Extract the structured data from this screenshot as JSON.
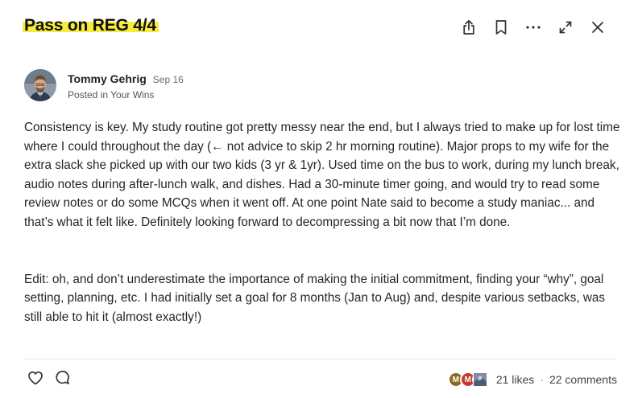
{
  "post": {
    "title": "Pass on REG 4/4",
    "author": "Tommy Gehrig",
    "date": "Sep 16",
    "posted_in": "Posted in Your Wins",
    "paragraph_1": "Consistency is key. My study routine got pretty messy near the end, but I always tried to make up for lost time where I could throughout the day (← not advice to skip 2 hr morning routine). Major props to my wife for the extra slack she picked up with our two kids (3 yr & 1yr). Used time on the bus to work, during my lunch break, audio notes during after-lunch walk, and dishes. Had a 30-minute timer going, and would try to read some review notes or do some MCQs when it went off. At one point Nate said to become a study maniac... and that’s what it felt like. Definitely looking forward to decompressing a bit now that I’m done.",
    "paragraph_2": "Edit: oh, and don’t underestimate the importance of making the initial commitment, finding your “why”, goal setting, planning, etc. I had initially set a goal for 8 months (Jan to Aug) and, despite various setbacks, was still able to hit it (almost exactly!)"
  },
  "toolbar": {
    "icons": [
      "share-icon",
      "bookmark-icon",
      "more-icon",
      "expand-icon",
      "close-icon"
    ]
  },
  "footer": {
    "likers": [
      {
        "initial": "M",
        "color": "#8a6a1e"
      },
      {
        "initial": "M",
        "color": "#c33a2f"
      },
      {
        "initial": "",
        "color": "#7d8fa5"
      }
    ],
    "likes": "21 likes",
    "separator": "·",
    "comments": "22 comments"
  },
  "colors": {
    "title_highlight": "#f6ec3c",
    "text": "#262626"
  }
}
